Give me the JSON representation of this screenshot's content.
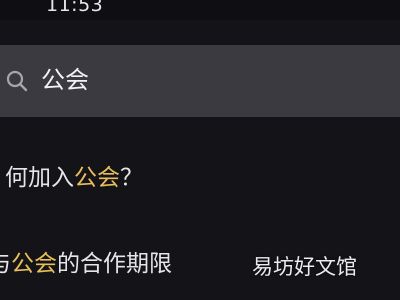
{
  "status_bar": {
    "time": "11:53"
  },
  "search": {
    "query": "公会",
    "icon": "search-icon"
  },
  "results": [
    {
      "before": "何加入",
      "keyword": "公会",
      "after": "？"
    },
    {
      "before": "与",
      "keyword": "公会",
      "after": "的合作期限"
    }
  ],
  "watermark": "易坊好文馆",
  "colors": {
    "background": "#131318",
    "search_bar": "#3a3a40",
    "highlight": "#e8bf5a",
    "text": "#e6e6e8"
  }
}
